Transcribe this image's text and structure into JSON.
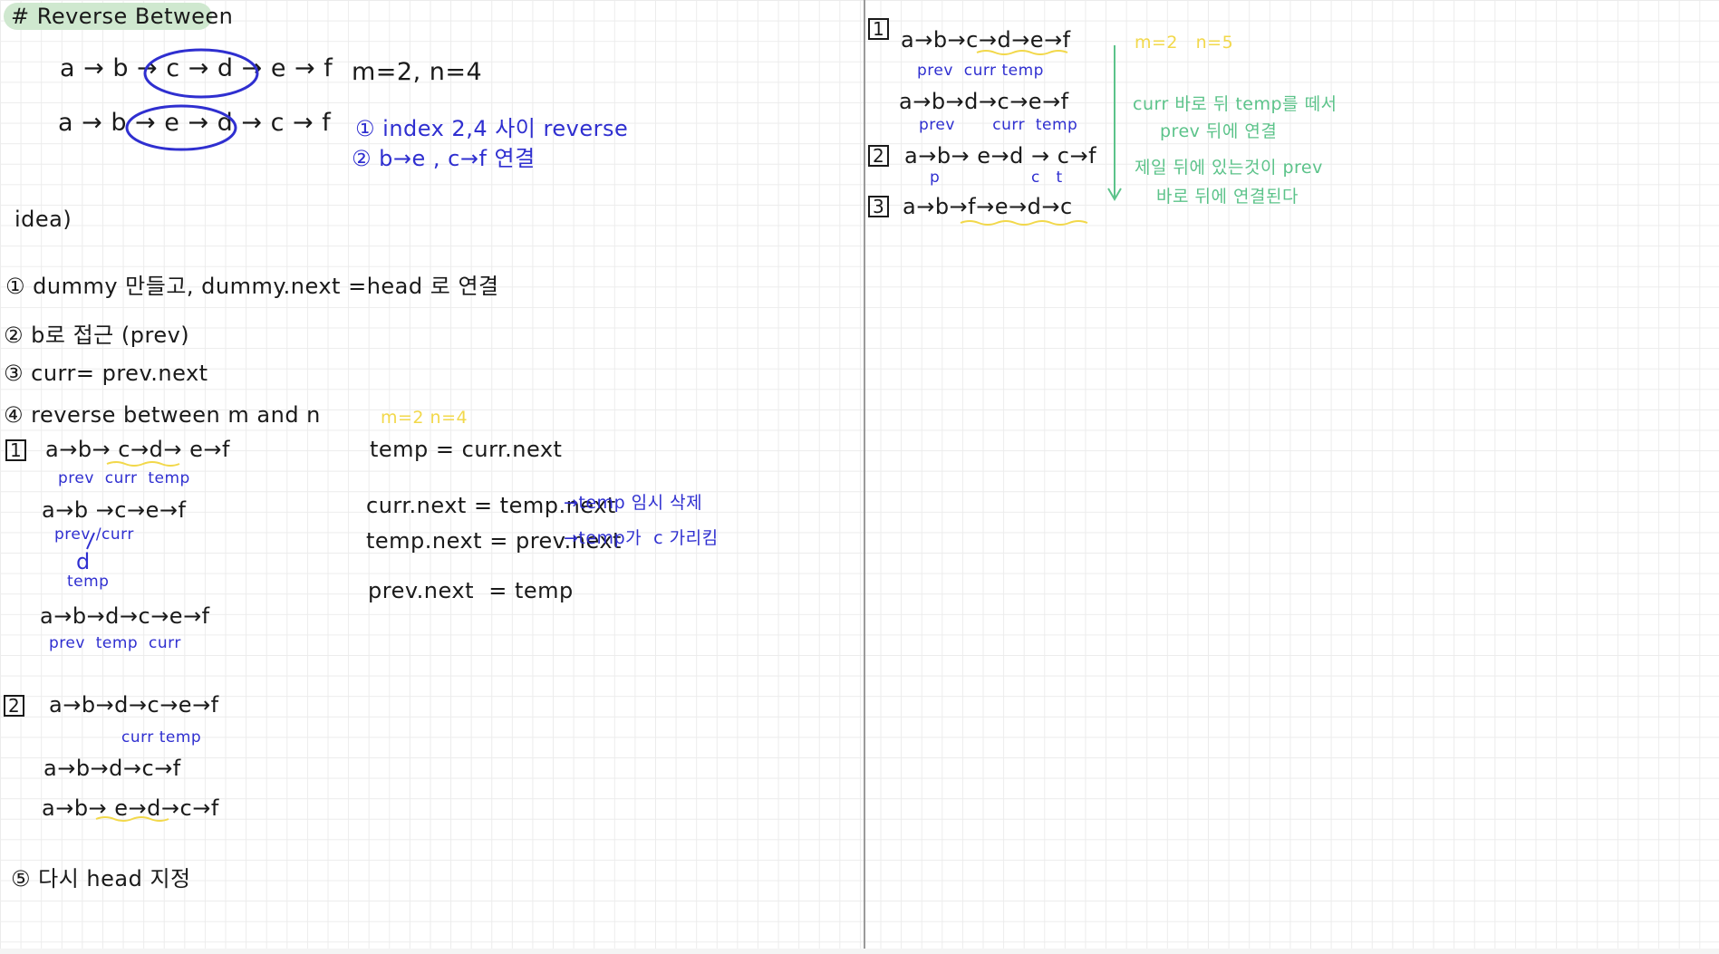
{
  "title": "# Reverse Between",
  "example": {
    "line1": "a → b → c → d → e → f",
    "line2": "a → b → e → d → c → f",
    "params": "m=2, n=4",
    "note1": "① index 2,4 사이 reverse",
    "note2": "② b→e , c→f 연결"
  },
  "idea_label": "idea)",
  "steps": {
    "s1": "① dummy 만들고, dummy.next =head 로 연결",
    "s2": "② b로 접근 (prev)",
    "s3": "③ curr= prev.next",
    "s4": "④ reverse between m and n",
    "s5": "⑤ 다시 head 지정"
  },
  "iteration1": {
    "num": "1",
    "params": "m=2 n=4",
    "line_a": "a→b→ c→d→ e→f",
    "labels_a": "prev  curr  temp",
    "line_b": "a→b →c→e→f",
    "labels_b": "prev /curr",
    "d_label": "d",
    "temp_label": "temp",
    "line_c": "a→b→d→c→e→f",
    "labels_c": "prev  temp  curr"
  },
  "code": {
    "c1": "temp = curr.next",
    "c2": "curr.next = temp.next",
    "c2_note": "→temp 임시 삭제",
    "c3": "temp.next = prev.next",
    "c3_note": "→temp가  c 가리킴",
    "c4": "prev.next  = temp"
  },
  "iteration2": {
    "num": "2",
    "line_a": "a→b→d→c→e→f",
    "labels_a": "curr temp",
    "line_b": "a→b→d→c→f",
    "line_c": "a→b→ e→d→c→f"
  },
  "right": {
    "params": "m=2   n=5",
    "r1_num": "1",
    "r1_line": "a→b→c→d→e→f",
    "r1_labels": "prev  curr temp",
    "r1b_line": "a→b→d→c→e→f",
    "r1b_labels": "prev       curr  temp",
    "r2_num": "2",
    "r2_line": "a→b→ e→d → c→f",
    "r2_p": "p",
    "r2_ct": "c   t",
    "r3_num": "3",
    "r3_line": "a→b→f→e→d→c",
    "green1": "curr 바로 뒤 temp를 떼서",
    "green2": "prev 뒤에 연결",
    "green3": "제일 뒤에 있는것이 prev",
    "green4": "바로 뒤에 연결된다"
  }
}
